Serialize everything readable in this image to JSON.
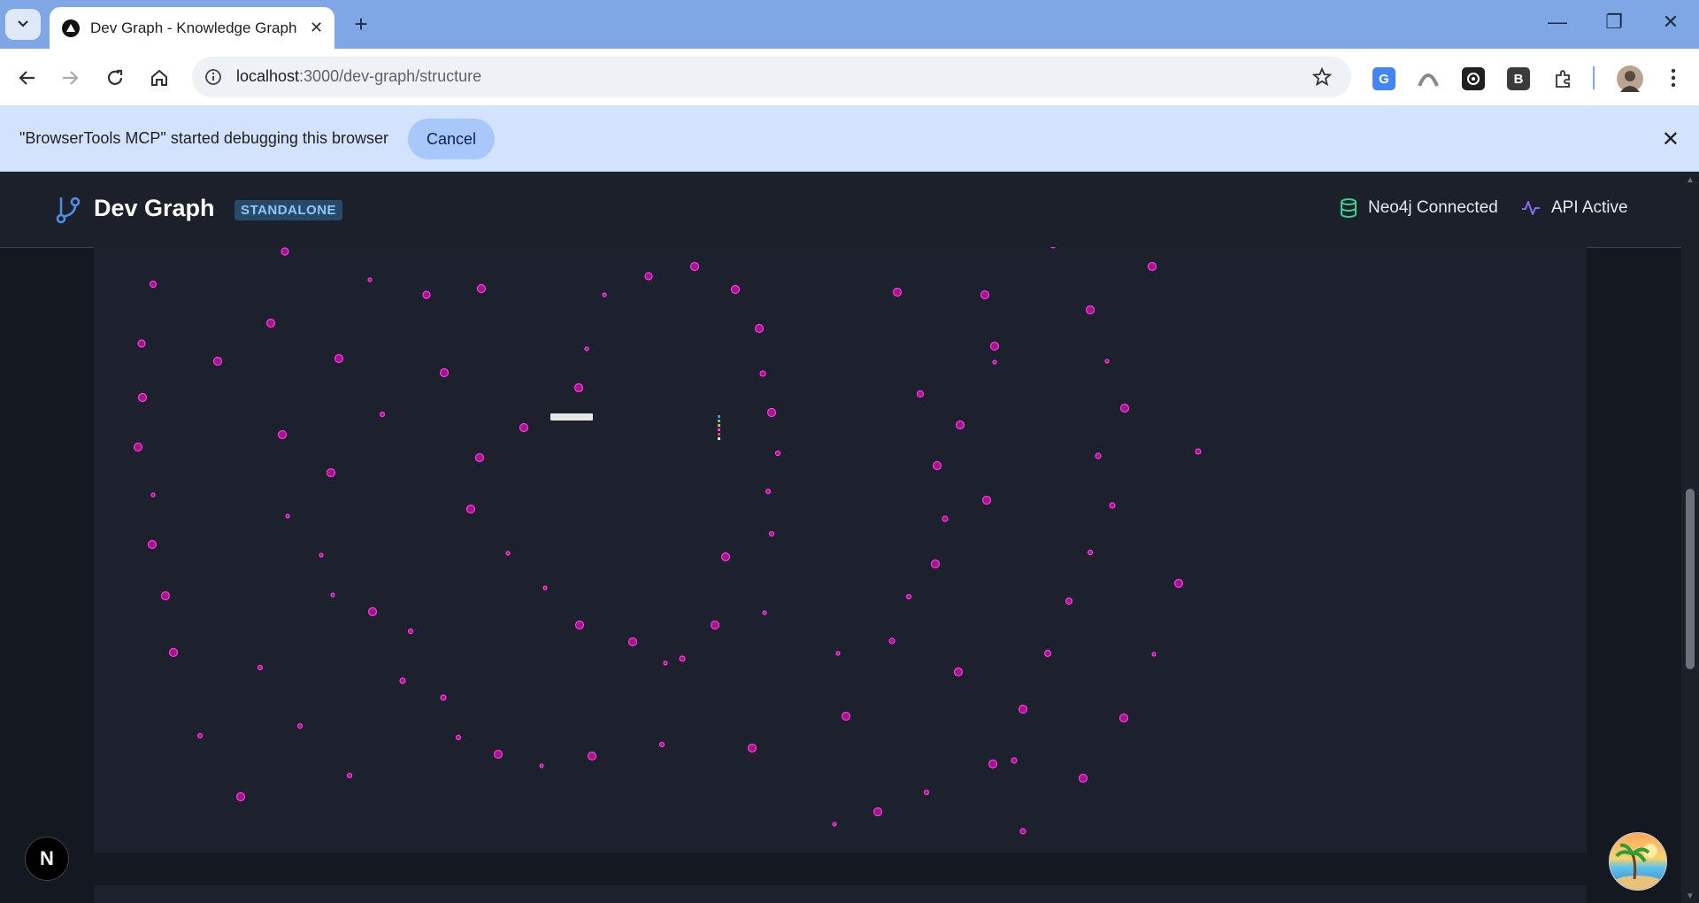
{
  "browser": {
    "tab_title": "Dev Graph - Knowledge Graph",
    "url_host": "localhost",
    "url_path": ":3000/dev-graph/structure",
    "extensions": [
      "translate-icon",
      "arc-icon",
      "openai-icon",
      "b-extension-icon",
      "puzzle-icon"
    ],
    "ext_b_label": "B"
  },
  "infobar": {
    "message": "\"BrowserTools MCP\" started debugging this browser",
    "cancel_label": "Cancel"
  },
  "header": {
    "title": "Dev Graph",
    "badge": "STANDALONE",
    "neo4j_status": "Neo4j Connected",
    "api_status": "API Active"
  },
  "colors": {
    "node_fill": "#a4148f",
    "node_stroke": "#ff38e0",
    "accent": "#4a8fe0",
    "neo4j": "#3ccf91",
    "api": "#8a6cf0"
  },
  "fab": {
    "next_label": "N"
  }
}
